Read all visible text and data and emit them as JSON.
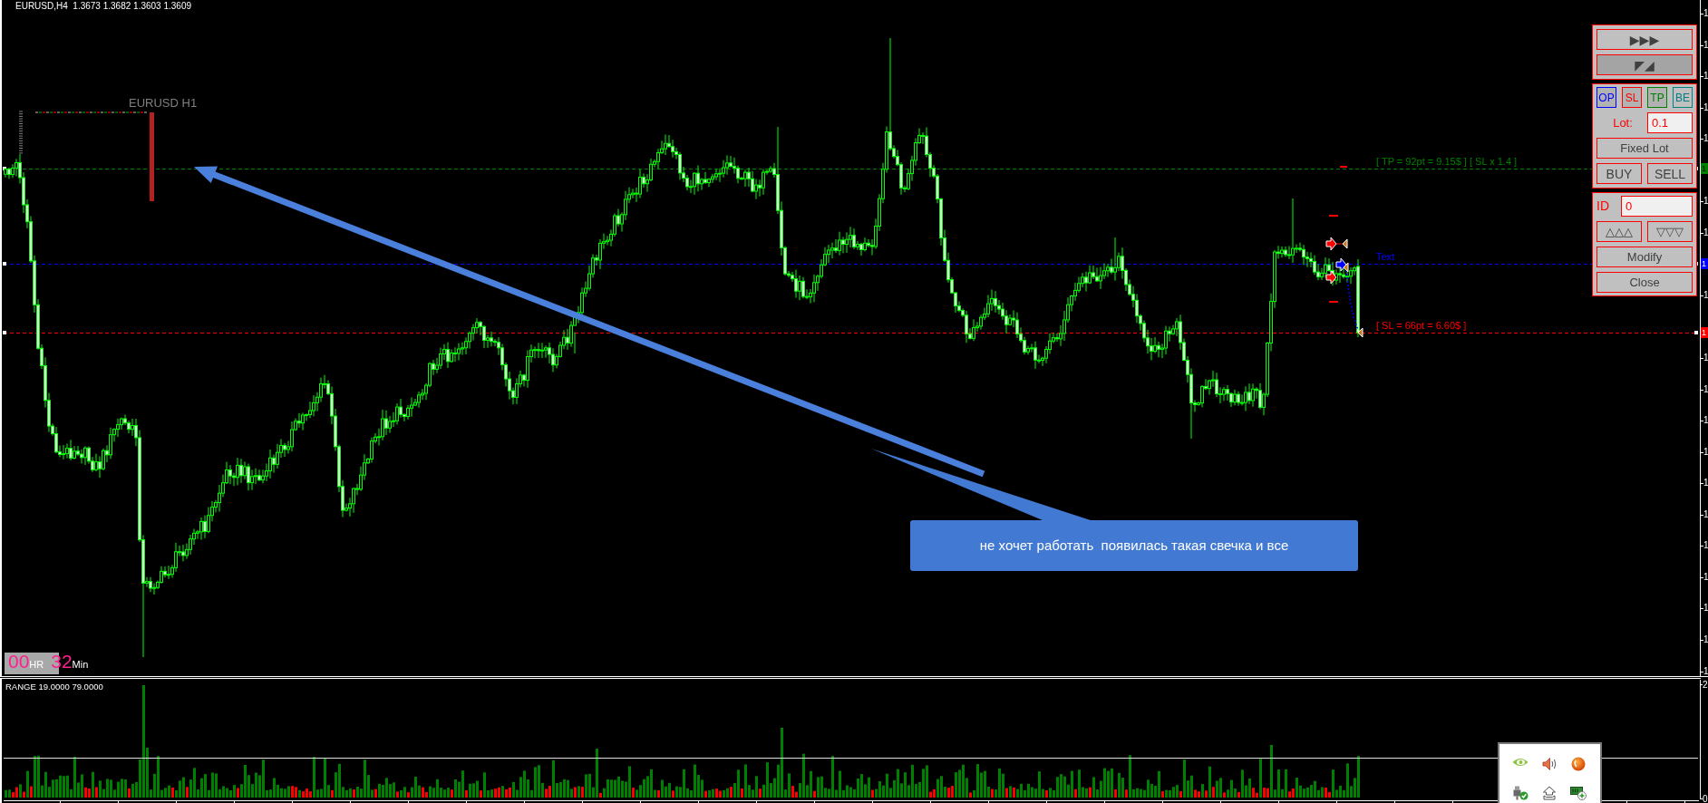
{
  "chart": {
    "header": "EURUSD,H4  1.3673 1.3682 1.3603 1.3609",
    "mini_chart_label": "EURUSD H1",
    "levels": [
      {
        "kind": "tp",
        "label": "[ TP = 92pt = 9.15$ ] [ SL x 1.4 ]",
        "price_tag": "1",
        "color": "#008000"
      },
      {
        "kind": "entry",
        "label": "Text",
        "price_tag": "1",
        "color": "#0000ff"
      },
      {
        "kind": "sl",
        "label": "[ SL = 66pt = 6.60$ ]",
        "price_tag": "1",
        "color": "#ff0000"
      }
    ],
    "price_axis": [
      "1",
      "1",
      "1",
      "1",
      "1",
      "1",
      "1",
      "1",
      "1",
      "1",
      "1",
      "1",
      "1",
      "1",
      "1",
      "1",
      "1",
      "1",
      "1"
    ],
    "timer": {
      "hours": "00",
      "hours_unit": "HR",
      "minutes": "32",
      "minutes_unit": "Min"
    },
    "callout": "не хочет работать  появилась такая свечка и все"
  },
  "trade_panel": {
    "nav_buttons": [
      {
        "label": "▶▶▶",
        "pressed": false
      },
      {
        "label": "◤◢",
        "pressed": true
      }
    ],
    "mode_buttons": [
      {
        "label": "OP",
        "color": "#0000ff",
        "pressed": true
      },
      {
        "label": "SL",
        "color": "#ff0000",
        "pressed": true
      },
      {
        "label": "TP",
        "color": "#008000",
        "pressed": true
      },
      {
        "label": "BE",
        "color": "#008080",
        "pressed": false
      }
    ],
    "lot": {
      "label": "Lot:",
      "value": "0.1"
    },
    "lot_mode_button": "Fixed Lot",
    "order_buttons": [
      "BUY",
      "SELL"
    ],
    "id": {
      "label": "ID",
      "value": "0"
    },
    "step_buttons": [
      "△△△",
      "▽▽▽"
    ],
    "action_buttons": [
      "Modify",
      "Close"
    ]
  },
  "indicator": {
    "label": "RANGE 19.0000 79.0000",
    "price_axis": [
      "2",
      "0"
    ]
  }
}
